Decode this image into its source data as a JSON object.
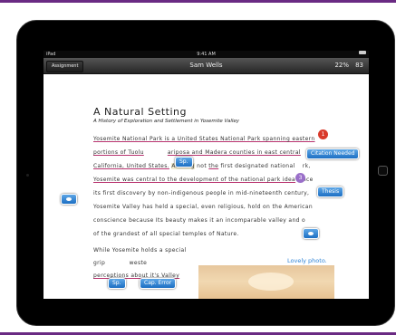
{
  "statusbar": {
    "device": "iPad",
    "time": "9:41 AM"
  },
  "navbar": {
    "button": "Assignment",
    "title": "Sam Wells",
    "percent": "22%",
    "page": "83"
  },
  "document": {
    "title": "A Natural Setting",
    "subtitle": "A History of Exploration and Settlement in Yosemite Valley",
    "lines": [
      "Yosemite National Park is a United States National Park spanning eastern",
      "portions of Tuolu",
      "ariposa and Madera counties in east central",
      "California, United States.",
      "Althoug",
      " not ",
      "the",
      " first designated national ",
      "rk,",
      "Yosemite was central to the development of the national park idea",
      " since",
      "its first discovery by non-indigenous people in mid-nineteenth century,",
      "Yosemite Valley has held a special, even religious, hold on the American",
      "conscience because Its beauty makes it an incomparable valley and o",
      "of the grandest of all special temples of Nature.",
      "While Yosemite holds a special",
      "grip ",
      " weste",
      "perceptions about it's Valley"
    ]
  },
  "annotations": {
    "sp1": "Sp.",
    "citation": "Citation Needed",
    "thesis": "Thesis",
    "sp2": "Sp.",
    "cap_error": "Cap. Error",
    "badge_1": "1",
    "badge_3": "3",
    "caption": "Lovely photo."
  }
}
